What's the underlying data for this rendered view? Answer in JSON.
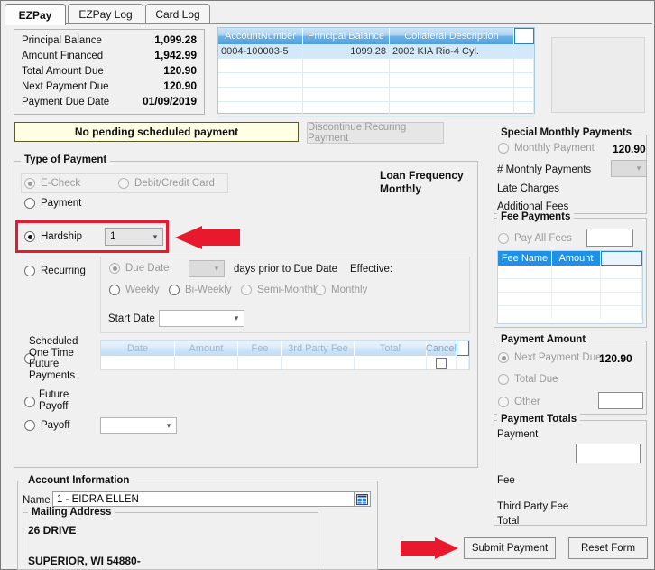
{
  "window": {
    "title": "EZPay"
  },
  "tabs": [
    {
      "label": "EZPay",
      "active": true
    },
    {
      "label": "EZPay Log",
      "active": false
    },
    {
      "label": "Card Log",
      "active": false
    }
  ],
  "summary": [
    {
      "label": "Principal Balance",
      "value": "1,099.28"
    },
    {
      "label": "Amount Financed",
      "value": "1,942.99"
    },
    {
      "label": "Total Amount Due",
      "value": "120.90"
    },
    {
      "label": "Next Payment Due",
      "value": "120.90"
    },
    {
      "label": "Payment Due Date",
      "value": "01/09/2019"
    }
  ],
  "account_grid": {
    "columns": [
      "AccountNumber",
      "Principal Balance",
      "Collateral Description"
    ],
    "rows": [
      [
        "0004-100003-5",
        "1099.28",
        "2002 KIA Rio-4 Cyl."
      ],
      [
        "",
        "",
        ""
      ],
      [
        "",
        "",
        ""
      ],
      [
        "",
        "",
        ""
      ],
      [
        "",
        "",
        ""
      ]
    ]
  },
  "banner": {
    "text": "No pending scheduled payment"
  },
  "discontinue_button": {
    "label": "Discontinue Recuring Payment",
    "enabled": false
  },
  "type_of_payment": {
    "title": "Type of Payment",
    "echeck": {
      "label": "E-Check",
      "selected": true,
      "enabled": false
    },
    "debit_credit": {
      "label": "Debit/Credit Card",
      "selected": false,
      "enabled": false
    },
    "payment": {
      "label": "Payment",
      "selected": false,
      "enabled": true
    },
    "hardship": {
      "label": "Hardship",
      "selected": true,
      "enabled": true,
      "count": "1"
    },
    "recurring": {
      "label": "Recurring",
      "selected": false,
      "enabled": true
    },
    "due_date": {
      "label": "Due Date",
      "selected": true,
      "enabled": false,
      "value": ""
    },
    "days_prior": {
      "label": "days prior to Due Date"
    },
    "effective": {
      "label": "Effective:"
    },
    "weekly": {
      "label": "Weekly",
      "selected": false
    },
    "biweekly": {
      "label": "Bi-Weekly",
      "selected": false
    },
    "semimonthly": {
      "label": "Semi-Monthly",
      "selected": false
    },
    "monthly": {
      "label": "Monthly",
      "selected": false
    },
    "start_date": {
      "label": "Start Date",
      "value": ""
    },
    "scheduled_one_time": {
      "label": "Scheduled One Time Future Payments",
      "selected": false
    },
    "future_payoff": {
      "label": "Future Payoff",
      "selected": false
    },
    "payoff": {
      "label": "Payoff",
      "selected": false,
      "value": ""
    }
  },
  "loan_frequency": {
    "label": "Loan Frequency",
    "value": "Monthly"
  },
  "scheduled_grid": {
    "columns": [
      "Date",
      "Amount",
      "Fee",
      "3rd Party Fee",
      "Total",
      "Cancel"
    ],
    "rows": [
      [
        "",
        "",
        "",
        "",
        "",
        ""
      ]
    ]
  },
  "special_monthly_payments": {
    "title": "Special Monthly Payments",
    "monthly_payment": {
      "label": "Monthly Payment",
      "value": "120.90",
      "selected": false,
      "enabled": false
    },
    "num_monthly_payments": {
      "label": "# Monthly Payments",
      "value": ""
    },
    "late_charges": {
      "label": "Late Charges",
      "value": ""
    },
    "additional_fees": {
      "label": "Additional Fees",
      "value": ""
    }
  },
  "fee_payments": {
    "title": "Fee Payments",
    "pay_all_fees": {
      "label": "Pay All Fees",
      "selected": false,
      "enabled": false,
      "value": ""
    },
    "columns": [
      "Fee Name",
      "Amount"
    ],
    "rows": [
      [
        "",
        ""
      ],
      [
        "",
        ""
      ],
      [
        "",
        ""
      ],
      [
        "",
        ""
      ]
    ]
  },
  "payment_amount": {
    "title": "Payment Amount",
    "next_payment_due": {
      "label": "Next Payment Due",
      "value": "120.90",
      "selected": true,
      "enabled": false
    },
    "total_due": {
      "label": "Total Due",
      "selected": false,
      "enabled": false
    },
    "other": {
      "label": "Other",
      "selected": false,
      "enabled": false,
      "value": ""
    }
  },
  "payment_totals": {
    "title": "Payment Totals",
    "payment": {
      "label": "Payment",
      "value": ""
    },
    "fee": {
      "label": "Fee",
      "value": ""
    },
    "third_party_fee": {
      "label": "Third Party Fee",
      "value": ""
    },
    "total": {
      "label": "Total",
      "value": ""
    }
  },
  "account_information": {
    "title": "Account Information",
    "name_label": "Name",
    "name_value": "1 - EIDRA ELLEN",
    "mailing_address_title": "Mailing Address",
    "address_line1": "26 DRIVE",
    "address_line2": "SUPERIOR, WI  54880-"
  },
  "actions": {
    "submit": "Submit Payment",
    "reset": "Reset Form"
  },
  "annotations": {
    "highlight_color": "#e8192c",
    "arrow_color": "#e8192c"
  },
  "icons": {
    "dropdown": "chevron-down-icon",
    "name_lookup": "list-lookup-icon"
  }
}
